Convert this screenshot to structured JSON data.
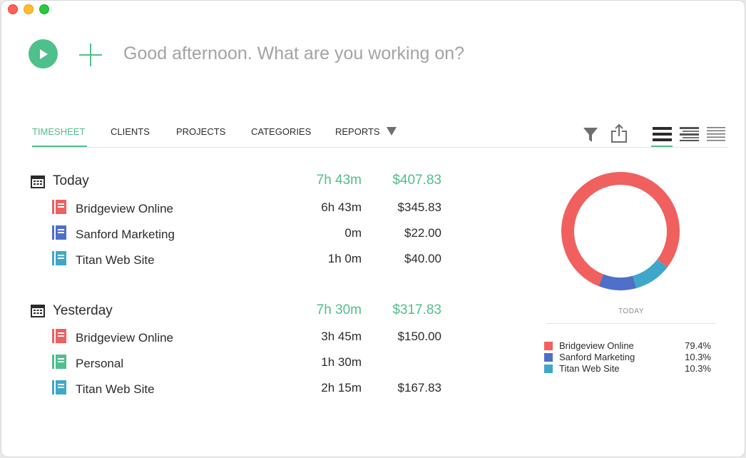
{
  "toolbar": {
    "prompt_placeholder": "Good afternoon. What are you working on?"
  },
  "tabs": [
    {
      "label": "TIMESHEET",
      "active": true
    },
    {
      "label": "CLIENTS",
      "active": false
    },
    {
      "label": "PROJECTS",
      "active": false
    },
    {
      "label": "CATEGORIES",
      "active": false
    },
    {
      "label": "REPORTS",
      "active": false,
      "icon": "dropdown-triangle-icon"
    }
  ],
  "tool_icons": [
    "filter-icon",
    "share-icon",
    "view-large-icon",
    "view-medium-icon",
    "view-compact-icon"
  ],
  "colors": {
    "accent": "#4fbf8c",
    "bridgeview": "#f0605e",
    "sanford": "#4e70c8",
    "titan": "#3fa7c9",
    "personal": "#4fbf8c"
  },
  "groups": [
    {
      "title": "Today",
      "total_time": "7h 43m",
      "total_amount": "$407.83",
      "rows": [
        {
          "name": "Bridgeview Online",
          "time": "6h 43m",
          "amount": "$345.83",
          "color": "#f0605e"
        },
        {
          "name": "Sanford Marketing",
          "time": "0m",
          "amount": "$22.00",
          "color": "#4e70c8"
        },
        {
          "name": "Titan Web Site",
          "time": "1h 0m",
          "amount": "$40.00",
          "color": "#3fa7c9"
        }
      ]
    },
    {
      "title": "Yesterday",
      "total_time": "7h 30m",
      "total_amount": "$317.83",
      "rows": [
        {
          "name": "Bridgeview Online",
          "time": "3h 45m",
          "amount": "$150.00",
          "color": "#f0605e"
        },
        {
          "name": "Personal",
          "time": "1h 30m",
          "amount": "",
          "color": "#4fbf8c"
        },
        {
          "name": "Titan Web Site",
          "time": "2h 15m",
          "amount": "$167.83",
          "color": "#3fa7c9"
        }
      ]
    }
  ],
  "chart_data": {
    "type": "pie",
    "title": "TODAY",
    "categories": [
      "Bridgeview Online",
      "Sanford Marketing",
      "Titan Web Site"
    ],
    "values": [
      79.4,
      10.3,
      10.3
    ],
    "labels": [
      "79.4%",
      "10.3%",
      "10.3%"
    ],
    "colors": [
      "#f0605e",
      "#4e70c8",
      "#3fa7c9"
    ],
    "legend": "bottom"
  }
}
